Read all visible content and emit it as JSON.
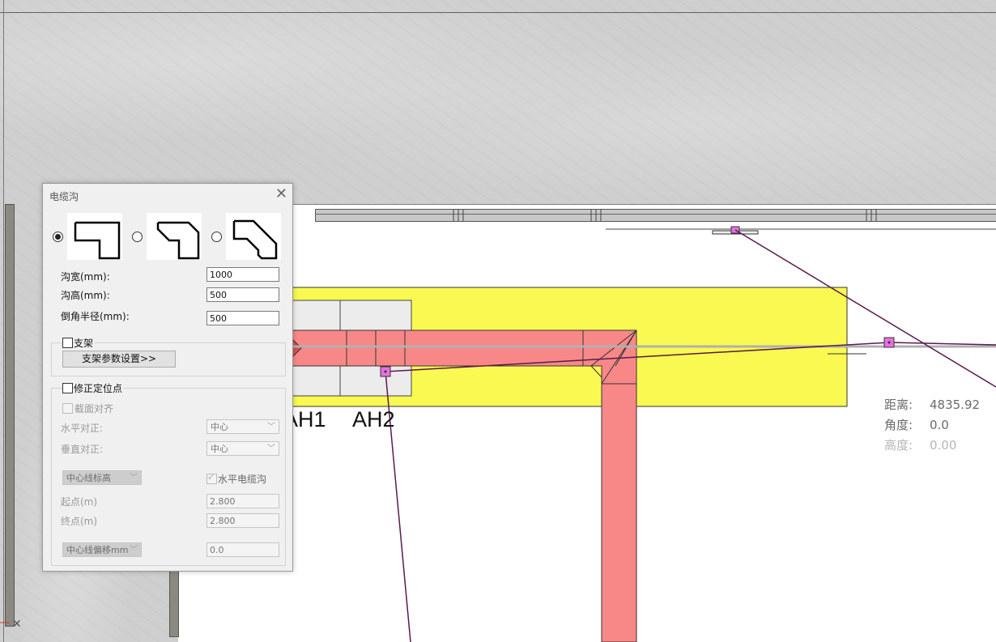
{
  "dialog": {
    "title": "电缆沟",
    "close_glyph": "✕",
    "shape_options": [
      "right-angle",
      "chamfer",
      "double-chamfer"
    ],
    "selected_shape": "right-angle",
    "width_label": "沟宽(mm):",
    "width_value": "1000",
    "height_label": "沟高(mm):",
    "height_value": "500",
    "radius_label": "倒角半径(mm):",
    "radius_value": "500",
    "bracket_label": "支架",
    "bracket_button": "支架参数设置>>",
    "fix_point_label": "修正定位点",
    "section_align_label": "截面对齐",
    "h_align_label": "水平对正:",
    "h_align_value": "中心",
    "v_align_label": "垂直对正:",
    "v_align_value": "中心",
    "centerline_elev_option": "中心线标高",
    "horizontal_trench_label": "水平电缆沟",
    "start_label": "起点(m)",
    "start_value": "2.800",
    "end_label": "终点(m)",
    "end_value": "2.800",
    "offset_option": "中心线偏移mm",
    "offset_value": "0.0"
  },
  "canvas": {
    "labels": [
      "AH1",
      "AH2"
    ],
    "info": {
      "distance_label": "距离:",
      "distance_value": "4835.92",
      "angle_label": "角度:",
      "angle_value": "0.0",
      "height_label": "高度:",
      "height_value": "0.00"
    }
  },
  "colors": {
    "trench": "#f88888",
    "pad": "#f9f952",
    "wall": "#cfcfcf",
    "cursor_line": "#5a1a4a",
    "marker": "#e870e0"
  }
}
